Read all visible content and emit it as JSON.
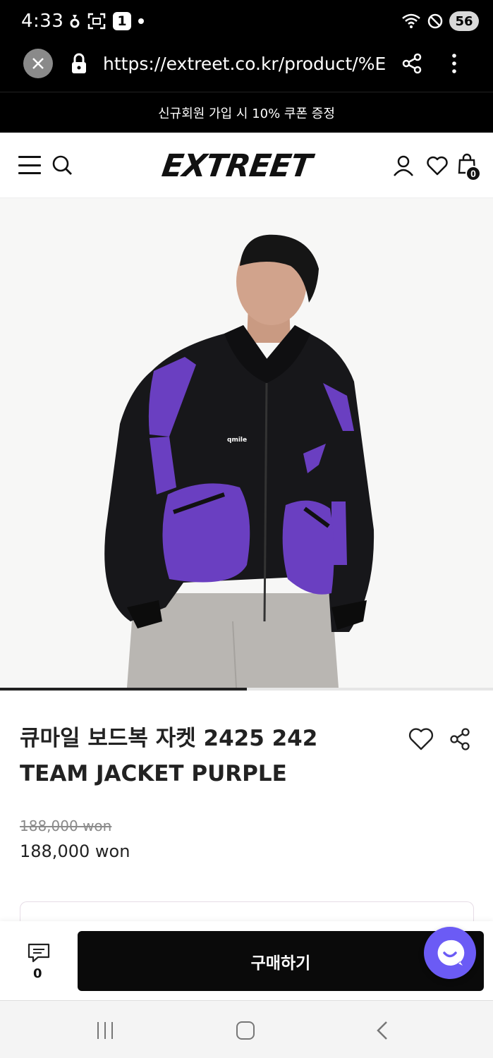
{
  "status_bar": {
    "time": "4:33",
    "notification_badge": "1",
    "battery": "56"
  },
  "browser": {
    "url": "https://extreet.co.kr/product/%E"
  },
  "promo_banner": {
    "text": "신규회원 가입 시 10% 쿠폰 증정"
  },
  "header": {
    "logo": "EXTREET",
    "cart_count": "0"
  },
  "hero": {
    "carousel_progress": 0.5,
    "logo_text": "qmile"
  },
  "product": {
    "title_line1": "큐마일 보드복 자켓 2425 242",
    "title_line2": "TEAM JACKET PURPLE",
    "original_price": "188,000 won",
    "sale_price": "188,000 won"
  },
  "bottom_bar": {
    "review_count": "0",
    "buy_label": "구매하기"
  },
  "colors": {
    "accent_purple": "#6b5bf5",
    "jacket_purple": "#6a3fc1",
    "black": "#0a0a0a"
  }
}
